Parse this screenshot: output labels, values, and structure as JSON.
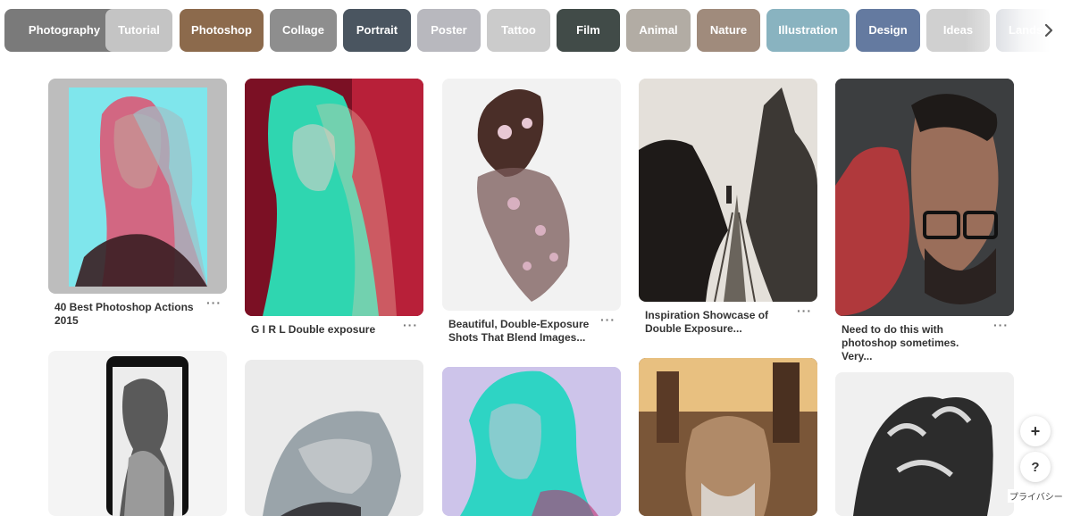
{
  "categories": [
    {
      "label": "Photography",
      "color": "#7a7a7a"
    },
    {
      "label": "Tutorial",
      "color": "#c4c4c4"
    },
    {
      "label": "Photoshop",
      "color": "#8c6a4c"
    },
    {
      "label": "Collage",
      "color": "#8e8e8e"
    },
    {
      "label": "Portrait",
      "color": "#4a5560"
    },
    {
      "label": "Poster",
      "color": "#b8b8be"
    },
    {
      "label": "Tattoo",
      "color": "#cbcbcb"
    },
    {
      "label": "Film",
      "color": "#414b48"
    },
    {
      "label": "Animal",
      "color": "#b2aca4"
    },
    {
      "label": "Nature",
      "color": "#a08b7c"
    },
    {
      "label": "Illustration",
      "color": "#89b3c0"
    },
    {
      "label": "Design",
      "color": "#647aa0"
    },
    {
      "label": "Ideas",
      "color": "#d0d0d0"
    },
    {
      "label": "Landscape",
      "color": "#c4c8d0"
    }
  ],
  "pins": [
    {
      "title": "40 Best Photoshop Actions 2015",
      "more": "···"
    },
    {
      "title": "G I R L Double exposure",
      "more": "···"
    },
    {
      "title": "Beautiful, Double-Exposure Shots That Blend Images...",
      "more": "···"
    },
    {
      "title": "Inspiration Showcase of Double Exposure...",
      "more": "···"
    },
    {
      "title": "Need to do this with photoshop sometimes. Very...",
      "more": "···"
    }
  ],
  "fab": {
    "add": "+",
    "help": "?"
  },
  "privacy_label": "プライバシー",
  "icons": {
    "next": "chevron-right-icon"
  }
}
